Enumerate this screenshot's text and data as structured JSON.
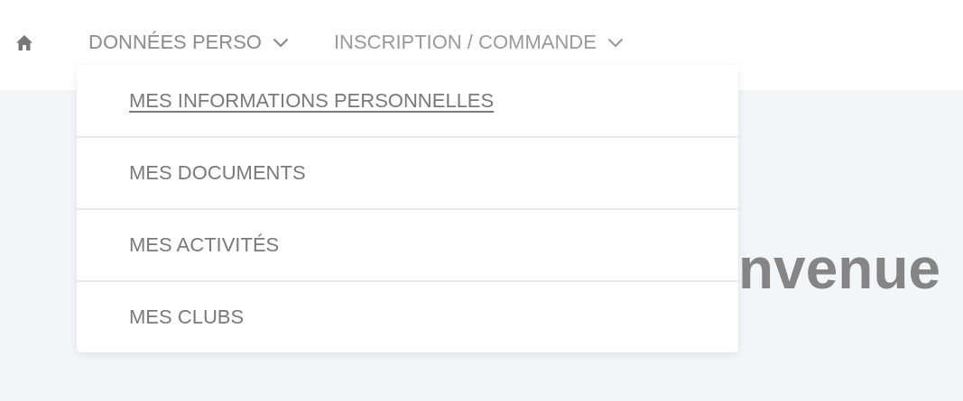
{
  "nav": {
    "items": [
      {
        "label": "DONNÉES PERSO",
        "expanded": true
      },
      {
        "label": "INSCRIPTION / COMMANDE",
        "expanded": false
      }
    ]
  },
  "dropdown": {
    "items": [
      {
        "label": "MES INFORMATIONS PERSONNELLES",
        "selected": true
      },
      {
        "label": "MES DOCUMENTS",
        "selected": false
      },
      {
        "label": "MES ACTIVITÉS",
        "selected": false
      },
      {
        "label": "MES CLUBS",
        "selected": false
      }
    ]
  },
  "heading": "nvenue"
}
